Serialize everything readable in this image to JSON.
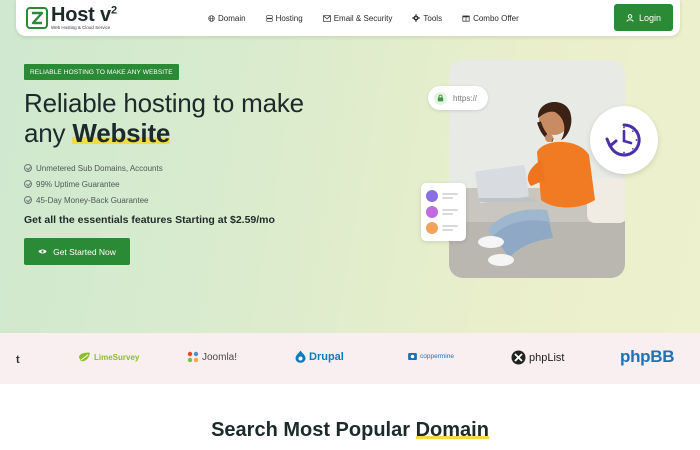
{
  "brand": {
    "name": "Host v",
    "superscript": "2",
    "tagline": "Web Hosting & Cloud Service",
    "accent_color": "#2a8a35",
    "highlight_color": "#f0dc47"
  },
  "nav": {
    "items": [
      {
        "label": "Domain",
        "icon": "globe-icon"
      },
      {
        "label": "Hosting",
        "icon": "server-icon"
      },
      {
        "label": "Email & Security",
        "icon": "envelope-icon"
      },
      {
        "label": "Tools",
        "icon": "gear-icon"
      },
      {
        "label": "Combo Offer",
        "icon": "gift-icon"
      }
    ],
    "login_label": "Login"
  },
  "hero": {
    "badge": "RELIABLE HOSTING TO MAKE ANY WEBSITE",
    "headline_line1": "Reliable hosting to make",
    "headline_line2_prefix": "any ",
    "headline_highlight": "Website",
    "features": [
      "Unmetered Sub Domains, Accounts",
      "99% Uptime Guarantee",
      "45-Day Money-Back Guarantee"
    ],
    "price_line": "Get all the essentials features Starting at $2.59/mo",
    "cta_label": "Get Started Now",
    "https_label": "https://"
  },
  "partners": [
    {
      "name": "LimeSurvey",
      "color": "#8bbf2a"
    },
    {
      "name": "Joomla!",
      "color": "#4a4a4a"
    },
    {
      "name": "Drupal",
      "color": "#0a7bbf"
    },
    {
      "name": "coppermine",
      "color": "#1f6fb0"
    },
    {
      "name": "phpList",
      "color": "#222222"
    },
    {
      "name": "phpBB",
      "color": "#1a73b8"
    }
  ],
  "partner_partial": "t",
  "section": {
    "title_prefix": "Search Most Popular ",
    "title_highlight": "Domain"
  }
}
